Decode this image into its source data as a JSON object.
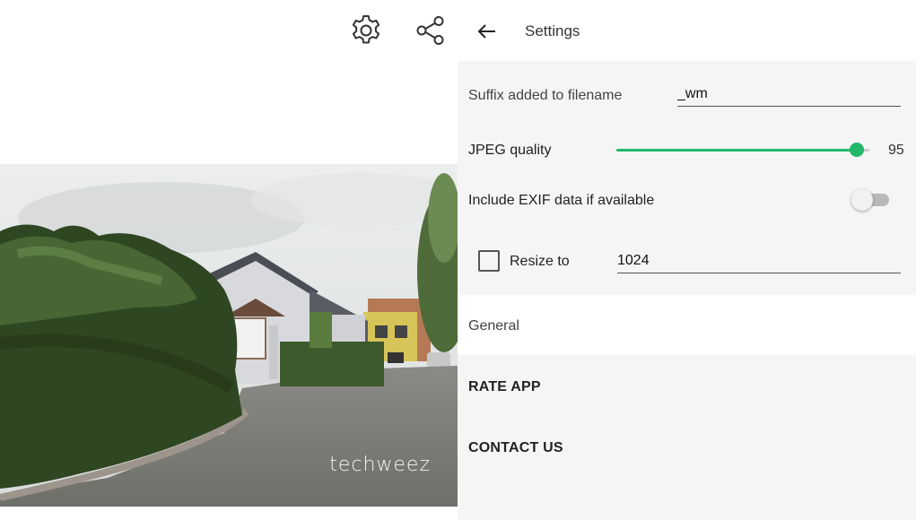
{
  "toolbar": {
    "settings_icon": "gear-icon",
    "share_icon": "share-icon"
  },
  "photo": {
    "watermark": "techweez"
  },
  "settings": {
    "back_icon": "arrow-left-icon",
    "title": "Settings",
    "suffix": {
      "label": "Suffix added to filename",
      "value": "_wm"
    },
    "jpeg_quality": {
      "label": "JPEG quality",
      "value": 95,
      "value_text": "95",
      "fraction": 0.95
    },
    "exif": {
      "label": "Include EXIF data if available",
      "enabled": false
    },
    "resize": {
      "label": "Resize to",
      "checked": false,
      "value": "1024"
    },
    "general_header": "General",
    "rate_app": "RATE APP",
    "contact_us": "CONTACT US"
  },
  "colors": {
    "accent": "#22b868",
    "panel_background": "#f5f5f5",
    "switch_off_track": "#b9b9b9"
  }
}
